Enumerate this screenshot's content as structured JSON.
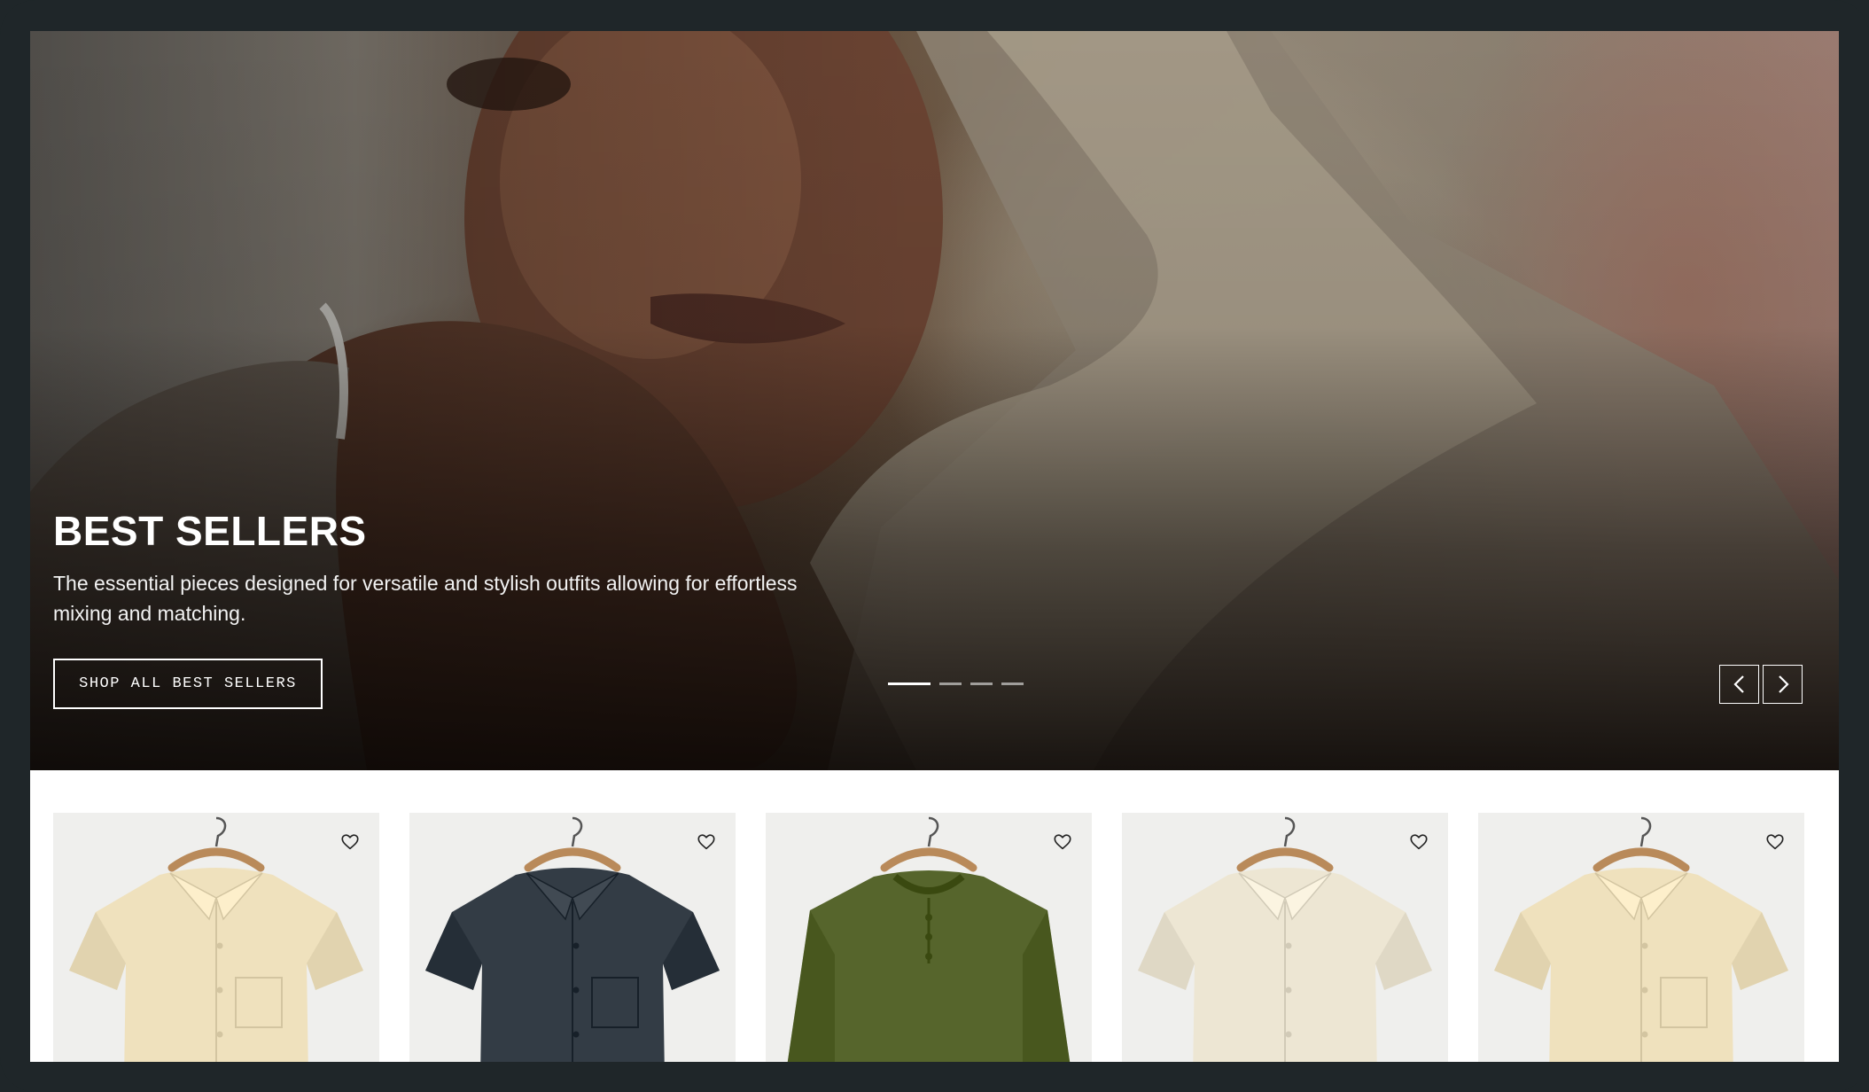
{
  "hero": {
    "title": "BEST SELLERS",
    "description": "The essential pieces designed for versatile and stylish outfits allowing for effortless mixing and matching.",
    "cta_label": "SHOP ALL BEST SELLERS",
    "carousel": {
      "slide_count": 4,
      "active_slide": 1
    }
  },
  "products": [
    {
      "color": "#efe1bd",
      "style": "short-sleeve shirt with pocket",
      "icon": "heart-icon"
    },
    {
      "color": "#333c45",
      "style": "short-sleeve camp shirt",
      "icon": "heart-icon"
    },
    {
      "color": "#56652c",
      "style": "knit henley",
      "icon": "heart-icon"
    },
    {
      "color": "#ede6d3",
      "style": "polo shirt",
      "icon": "heart-icon"
    },
    {
      "color": "#efe1bd",
      "style": "short-sleeve shirt with pocket",
      "icon": "heart-icon"
    }
  ],
  "colors": {
    "frame": "#1f2629",
    "card_bg": "#efefed",
    "hero_text": "#ffffff"
  }
}
